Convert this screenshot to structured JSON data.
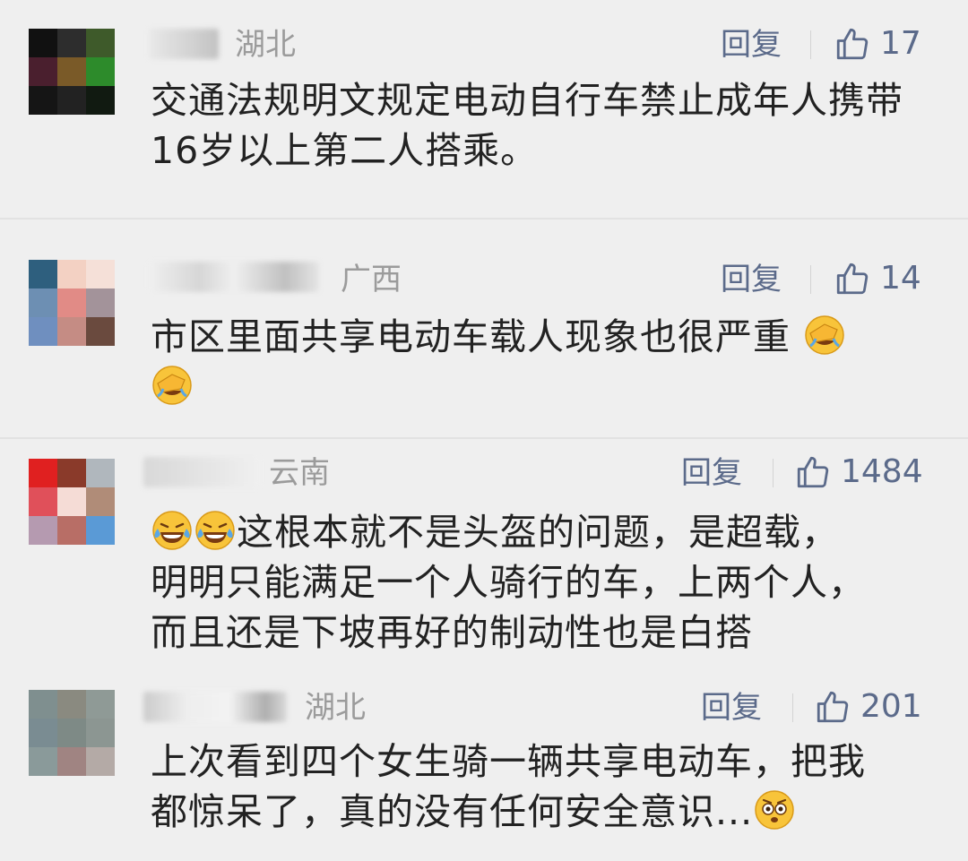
{
  "comments": [
    {
      "region": "湖北",
      "reply_label": "回复",
      "likes": "17",
      "text": "交通法规明文规定电动自行车禁止成年人携带16岁以上第二人搭乘。",
      "avatar_colors": [
        "#111111",
        "#2d2d2d",
        "#3e5a2a",
        "#4a1f2e",
        "#7a5a28",
        "#2d8b2b",
        "#151515",
        "#222222",
        "#111a11"
      ]
    },
    {
      "region": "广西",
      "reply_label": "回复",
      "likes": "14",
      "text_before": "市区里面共享电动车载人现象也很严重",
      "avatar_colors": [
        "#2e5f7e",
        "#f3d1c3",
        "#f5e0d8",
        "#6d8fb3",
        "#e18b86",
        "#a3939a",
        "#6f8fbf",
        "#c58c84",
        "#6a4a3e"
      ]
    },
    {
      "region": "云南",
      "reply_label": "回复",
      "likes": "1484",
      "text_after_emoji": "这根本就不是头盔的问题，是超载，",
      "text_line2": "明明只能满足一个人骑行的车，上两个人，",
      "text_line3": "而且还是下坡再好的制动性也是白搭",
      "avatar_colors": [
        "#e02020",
        "#8a3a2a",
        "#b0b7bd",
        "#e0505a",
        "#f5dcd6",
        "#b08c78",
        "#b59ab0",
        "#b86e66",
        "#5a9ad6"
      ]
    },
    {
      "region": "湖北",
      "reply_label": "回复",
      "likes": "201",
      "text_line1": "上次看到四个女生骑一辆共享电动车，把我",
      "text_line2": "都惊呆了，真的没有任何安全意识...",
      "avatar_colors": [
        "#7f8f8f",
        "#8a8a80",
        "#8f9a96",
        "#7a8c92",
        "#7e8a86",
        "#8c9692",
        "#8a9a9a",
        "#a08482",
        "#b4aaa6"
      ]
    }
  ]
}
